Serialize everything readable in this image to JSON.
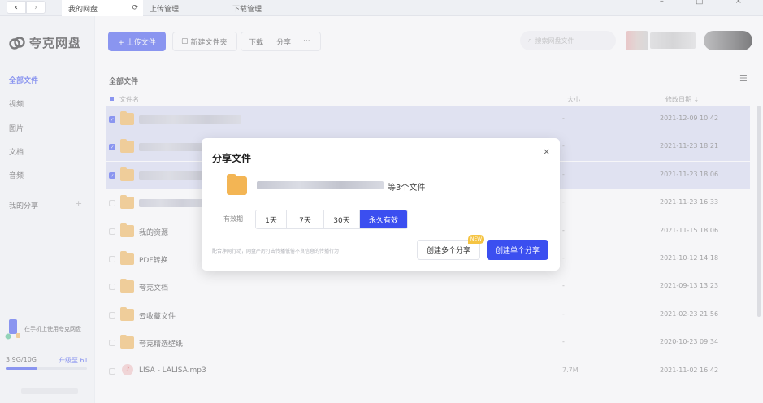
{
  "browser": {
    "back_glyph": "‹",
    "forward_glyph": "›",
    "tabs": [
      {
        "label": "我的网盘"
      },
      {
        "label": "上传管理"
      },
      {
        "label": "下载管理"
      }
    ],
    "refresh_glyph": "⟳",
    "window_controls": "– □ ×"
  },
  "sidebar": {
    "logo_text": "夸克网盘",
    "items": [
      {
        "label": "全部文件",
        "active": true
      },
      {
        "label": "视频"
      },
      {
        "label": "图片"
      },
      {
        "label": "文档"
      },
      {
        "label": "音频"
      },
      {
        "label": "我的分享"
      }
    ],
    "add_glyph": "+",
    "promo_text": "在手机上使用夸克网盘",
    "storage_text": "3.9G/10G",
    "storage_used_fraction": 0.39,
    "upgrade_label": "升级至 6T"
  },
  "toolbar": {
    "upload_label": "+ 上传文件",
    "new_folder_label": "新建文件夹",
    "download_label": "下载",
    "share_label": "分享",
    "more_label": "···",
    "search_placeholder": "搜索网盘文件"
  },
  "list": {
    "breadcrumb": "全部文件",
    "view_glyph": "☰",
    "columns": {
      "name": "文件名",
      "size": "大小",
      "modified": "修改日期 ↓"
    },
    "rows": [
      {
        "name": "",
        "size": "-",
        "modified": "2021-12-09 10:42",
        "selected": true
      },
      {
        "name": "",
        "size": "-",
        "modified": "2021-11-23 18:21",
        "selected": true
      },
      {
        "name": "",
        "size": "-",
        "modified": "2021-11-23 18:06",
        "selected": true
      },
      {
        "name": "",
        "size": "-",
        "modified": "2021-11-23 16:33",
        "selected": false
      },
      {
        "name": "我的资源",
        "size": "-",
        "modified": "2021-11-15 18:06",
        "selected": false
      },
      {
        "name": "PDF转换",
        "size": "-",
        "modified": "2021-10-12 14:18",
        "selected": false
      },
      {
        "name": "夸克文档",
        "size": "-",
        "modified": "2021-09-13 13:23",
        "selected": false
      },
      {
        "name": "云收藏文件",
        "size": "-",
        "modified": "2021-02-23 21:56",
        "selected": false
      },
      {
        "name": "夸克精选壁纸",
        "size": "-",
        "modified": "2020-10-23 09:34",
        "selected": false
      },
      {
        "name": "LISA - LALISA.mp3",
        "size": "7.7M",
        "modified": "2021-11-02 16:42",
        "selected": false
      }
    ]
  },
  "share_dialog": {
    "title": "分享文件",
    "close_glyph": "×",
    "file_count_text": "等3个文件",
    "validity_label": "有效期",
    "options": [
      {
        "label": "1天",
        "selected": false
      },
      {
        "label": "7天",
        "selected": false
      },
      {
        "label": "30天",
        "selected": false
      },
      {
        "label": "永久有效",
        "selected": true
      }
    ],
    "note": "配合净网行动，网盘严厉打击传播低俗不良信息的传播行为",
    "new_badge": "NEW",
    "create_multi_label": "创建多个分享",
    "create_single_label": "创建单个分享"
  },
  "colors": {
    "accent": "#3b4ff0",
    "folder": "#f3b554",
    "selected_row": "#d8dbf3"
  }
}
